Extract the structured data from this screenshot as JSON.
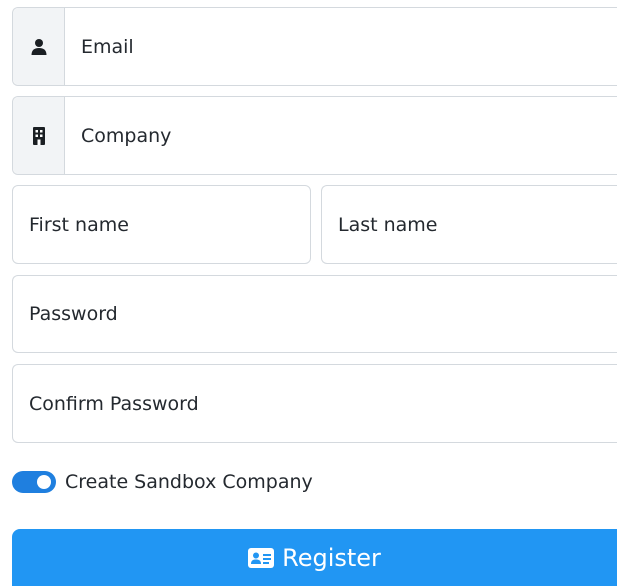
{
  "form": {
    "email": {
      "placeholder": "Email",
      "icon": "user-icon"
    },
    "company": {
      "placeholder": "Company",
      "icon": "building-icon"
    },
    "first_name": {
      "placeholder": "First name"
    },
    "last_name": {
      "placeholder": "Last name"
    },
    "password": {
      "placeholder": "Password"
    },
    "confirm_password": {
      "placeholder": "Confirm Password"
    },
    "sandbox_toggle": {
      "label": "Create Sandbox Company",
      "checked": true
    },
    "register_button": {
      "label": "Register",
      "icon": "id-card-icon"
    }
  },
  "colors": {
    "accent": "#2196f3",
    "switch_on": "#1f7fdf",
    "border": "#d4d9de",
    "addon_bg": "#f2f4f6",
    "text": "#24292f"
  }
}
